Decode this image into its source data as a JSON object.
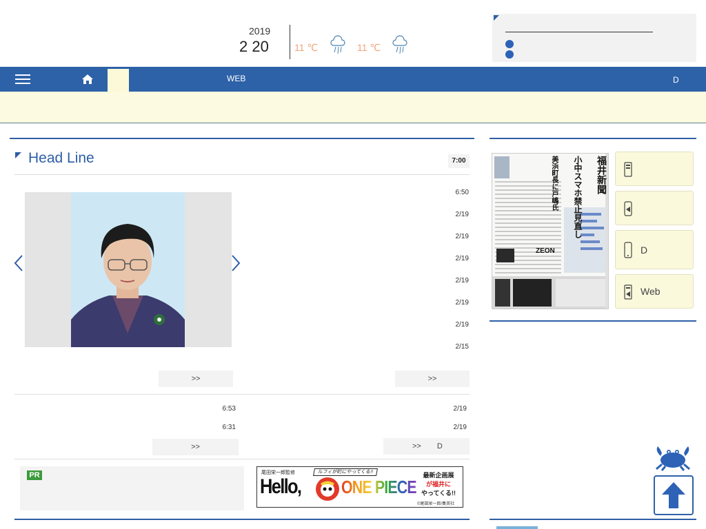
{
  "header": {
    "year": "2019",
    "date": "2 20",
    "weather": [
      {
        "temp": "11 ℃",
        "icon": "rain-icon"
      },
      {
        "temp": "11 ℃",
        "icon": "rain-icon"
      }
    ]
  },
  "notice": {
    "icon": "corner-triangle-icon",
    "bullets": [
      "",
      ""
    ]
  },
  "nav": {
    "web_label": "WEB",
    "d_label": "D"
  },
  "headline": {
    "title": "Head Line",
    "time": "7:00",
    "news_times": [
      "6:50",
      "2/19",
      "2/19",
      "2/19",
      "2/19",
      "2/19",
      "2/19",
      "2/15"
    ],
    "more_left": ">>",
    "more_right": ">>"
  },
  "sub_news": {
    "left_times": [
      "6:53",
      "6:31"
    ],
    "right_times": [
      "2/19",
      "2/19"
    ],
    "more_left": ">>",
    "more_right": ">>",
    "more_right_suffix": "D"
  },
  "pr": {
    "badge": "PR"
  },
  "banner": {
    "top_text": "尾田栄一郎監修",
    "tag": "ルフィが町にやってくる!!",
    "hello": "Hello,",
    "title": "ONE PIECE",
    "right1": "最新企画展",
    "right2": "が福井に",
    "right3": "やってくる!!",
    "copyright": "©尾田栄一郎/集英社"
  },
  "newspaper": {
    "masthead": "福井新聞",
    "headline": "小中スマホ禁止見直し",
    "sub": "美浜町長に戸嶋氏",
    "ad": "ZEON"
  },
  "services": [
    {
      "label": "",
      "icon": "tablet-icon"
    },
    {
      "label": "",
      "icon": "phone-icon"
    },
    {
      "label": "D",
      "icon": "phone-icon"
    },
    {
      "label": "Web",
      "icon": "tablet-icon"
    }
  ],
  "colors": {
    "brand": "#2d62a8",
    "accent_temp": "#f2a27a",
    "ticker_bg": "#fcfae0",
    "pr_green": "#3c9a3c"
  }
}
